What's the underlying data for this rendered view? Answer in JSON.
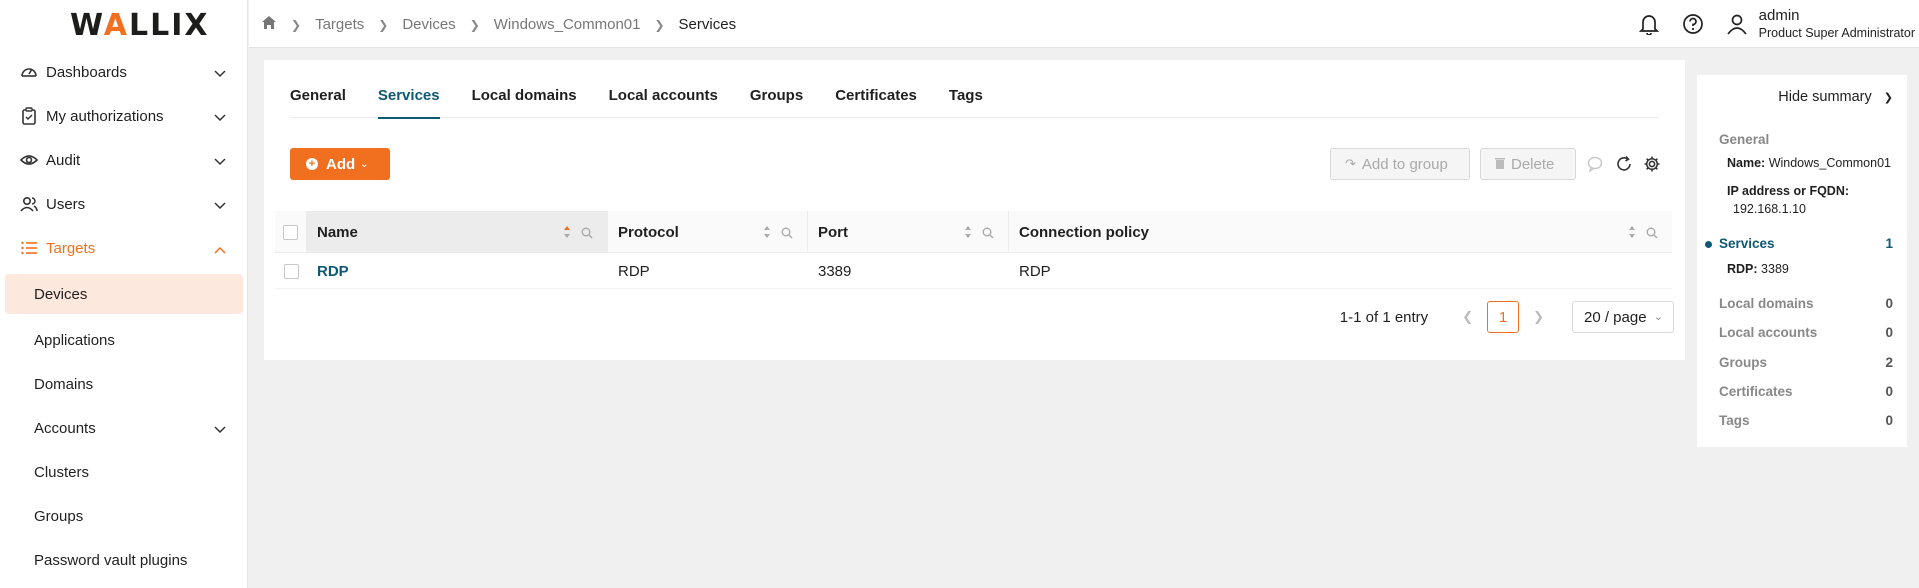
{
  "logo": {
    "text_pre": "W",
    "text_a": "A",
    "text_post": "LLIX"
  },
  "sidebar": {
    "items": [
      {
        "label": "Dashboards",
        "icon": "dashboard-icon"
      },
      {
        "label": "My authorizations",
        "icon": "clipboard-icon"
      },
      {
        "label": "Audit",
        "icon": "eye-icon"
      },
      {
        "label": "Users",
        "icon": "users-icon"
      },
      {
        "label": "Targets",
        "icon": "list-icon"
      }
    ],
    "sub_items": [
      "Devices",
      "Applications",
      "Domains",
      "Accounts",
      "Clusters",
      "Groups",
      "Password vault plugins"
    ]
  },
  "breadcrumb": [
    "Targets",
    "Devices",
    "Windows_Common01",
    "Services"
  ],
  "user": {
    "name": "admin",
    "role": "Product Super Administrator"
  },
  "tabs": [
    "General",
    "Services",
    "Local domains",
    "Local accounts",
    "Groups",
    "Certificates",
    "Tags"
  ],
  "toolbar": {
    "add_label": "Add",
    "add_to_group_label": "Add to group",
    "delete_label": "Delete"
  },
  "table": {
    "columns": [
      "Name",
      "Protocol",
      "Port",
      "Connection policy"
    ],
    "rows": [
      {
        "name": "RDP",
        "protocol": "RDP",
        "port": "3389",
        "policy": "RDP"
      }
    ]
  },
  "pager": {
    "count": "1-1 of 1 entry",
    "page": "1",
    "size": "20 / page"
  },
  "summary": {
    "toggle": "Hide summary",
    "general_title": "General",
    "name_key": "Name:",
    "name_val": "Windows_Common01",
    "ip_key": "IP address or FQDN:",
    "ip_val": "192.168.1.10",
    "services_title": "Services",
    "services_count": "1",
    "rdp_key": "RDP:",
    "rdp_val": "3389",
    "local_domains": "Local domains",
    "local_domains_count": "0",
    "local_accounts": "Local accounts",
    "local_accounts_count": "0",
    "groups": "Groups",
    "groups_count": "2",
    "certificates": "Certificates",
    "certificates_count": "0",
    "tags": "Tags",
    "tags_count": "0"
  },
  "colors": {
    "accent": "#f07020",
    "link": "#0f5a73"
  }
}
